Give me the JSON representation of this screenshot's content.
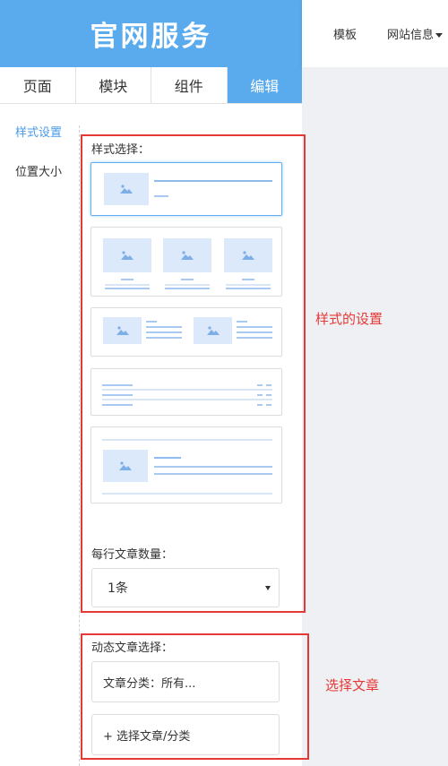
{
  "header": {
    "logo_text": "官网服务",
    "nav": [
      "模板",
      "网站信息"
    ]
  },
  "tabs": [
    {
      "label": "页面",
      "active": false
    },
    {
      "label": "模块",
      "active": false
    },
    {
      "label": "组件",
      "active": false
    },
    {
      "label": "编辑",
      "active": true
    }
  ],
  "sidebar": {
    "items": [
      {
        "label": "样式设置",
        "active": true
      },
      {
        "label": "位置大小",
        "active": false
      }
    ]
  },
  "style_section": {
    "label": "样式选择：",
    "selected_index": 0,
    "per_row_label": "每行文章数量：",
    "per_row_value": "1条"
  },
  "article_section": {
    "label": "动态文章选择：",
    "category_text": "文章分类：所有...",
    "select_button": "+ 选择文章/分类"
  },
  "annotations": {
    "style": "样式的设置",
    "article": "选择文章"
  },
  "colors": {
    "accent": "#5aabee",
    "annotation_red": "#e53935",
    "placeholder_blue": "#dce9fb"
  },
  "icons": {
    "image_placeholder": "image-placeholder-icon",
    "dropdown": "caret-down-icon"
  }
}
